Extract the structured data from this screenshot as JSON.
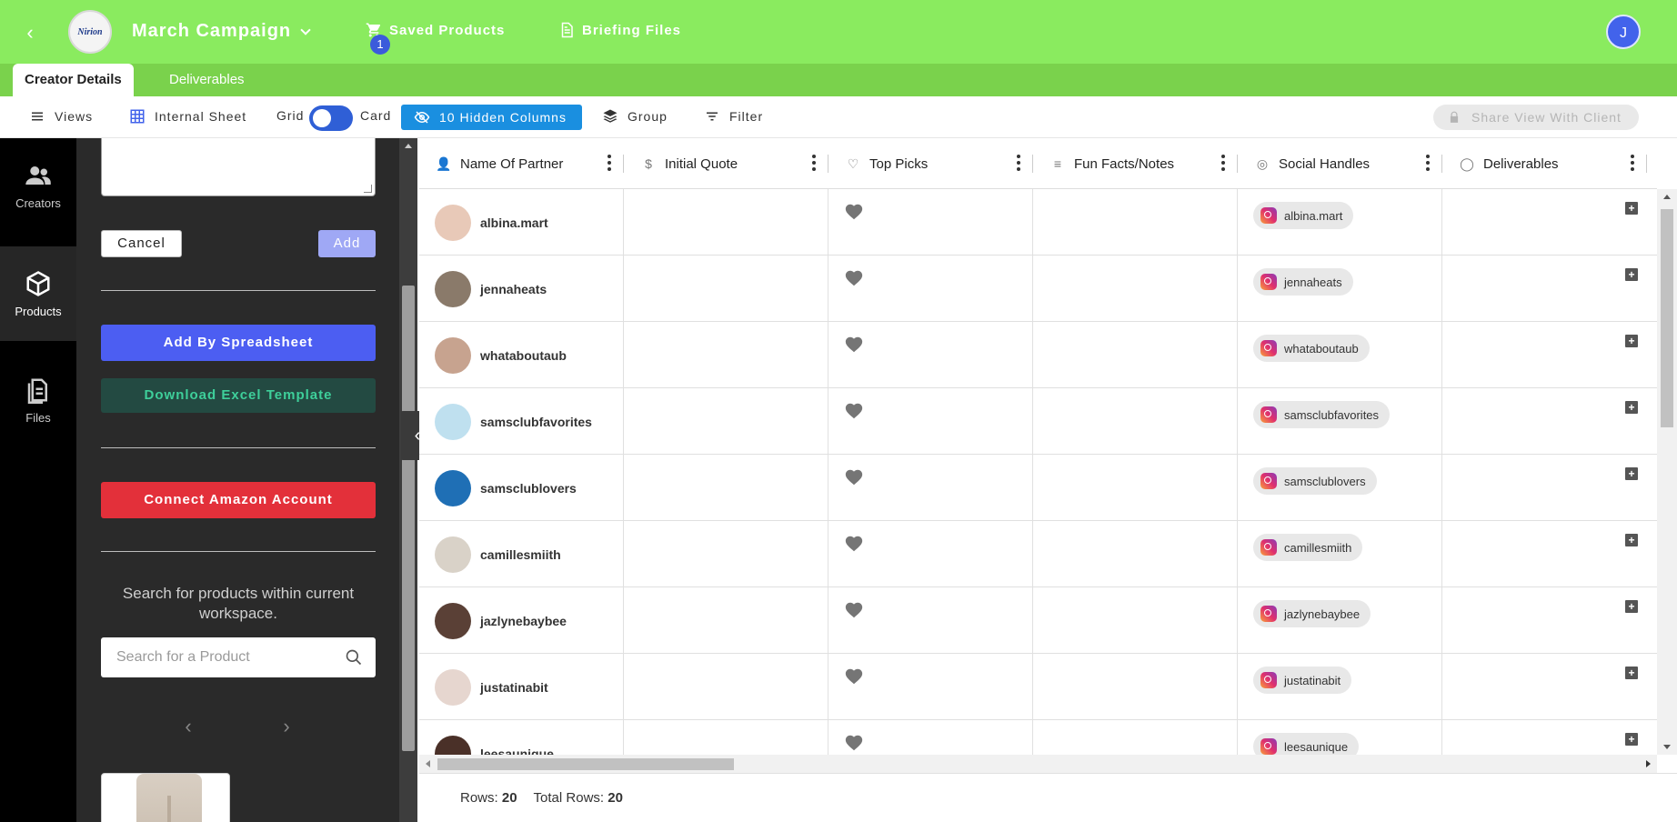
{
  "header": {
    "logo_text": "Nirion",
    "campaign_name": "March Campaign",
    "saved_products_label": "Saved Products",
    "saved_products_count": "1",
    "briefing_files_label": "Briefing Files",
    "user_initial": "J"
  },
  "tabs": [
    {
      "label": "Creator Details",
      "active": true
    },
    {
      "label": "Deliverables",
      "active": false
    }
  ],
  "toolbar": {
    "views_label": "Views",
    "sheet_label": "Internal Sheet",
    "grid_label": "Grid",
    "card_label": "Card",
    "hidden_columns_label": "10 Hidden Columns",
    "group_label": "Group",
    "filter_label": "Filter",
    "share_label": "Share View With Client"
  },
  "leftnav": {
    "items": [
      {
        "label": "Creators",
        "icon": "users-icon",
        "active": false
      },
      {
        "label": "Products",
        "icon": "box-icon",
        "active": true
      },
      {
        "label": "Files",
        "icon": "document-icon",
        "active": false
      }
    ]
  },
  "panel": {
    "cancel_label": "Cancel",
    "add_label": "Add",
    "spreadsheet_label": "Add By Spreadsheet",
    "excel_label": "Download Excel Template",
    "amazon_label": "Connect Amazon Account",
    "search_hint": "Search for products within current workspace.",
    "search_placeholder": "Search for a Product"
  },
  "table": {
    "columns": [
      {
        "label": "Name Of Partner",
        "icon": "person-icon"
      },
      {
        "label": "Initial Quote",
        "icon": "dollar-icon"
      },
      {
        "label": "Top Picks",
        "icon": "heart-outline-icon"
      },
      {
        "label": "Fun Facts/Notes",
        "icon": "lines-icon"
      },
      {
        "label": "Social Handles",
        "icon": "globe-icon"
      },
      {
        "label": "Deliverables",
        "icon": "circle-check-icon"
      }
    ],
    "rows": [
      {
        "partner": "albina.mart",
        "handle": "albina.mart",
        "avatar_color": "#e8c9b8"
      },
      {
        "partner": "jennaheats",
        "handle": "jennaheats",
        "avatar_color": "#8a7a6a"
      },
      {
        "partner": "whataboutaub",
        "handle": "whataboutaub",
        "avatar_color": "#c7a38f"
      },
      {
        "partner": "samsclubfavorites",
        "handle": "samsclubfavorites",
        "avatar_color": "#bfe0ef"
      },
      {
        "partner": "samsclublovers",
        "handle": "samsclublovers",
        "avatar_color": "#1f6fb5"
      },
      {
        "partner": "camillesmiith",
        "handle": "camillesmiith",
        "avatar_color": "#d9d2c8"
      },
      {
        "partner": "jazlynebaybee",
        "handle": "jazlynebaybee",
        "avatar_color": "#5a4036"
      },
      {
        "partner": "justatinabit",
        "handle": "justatinabit",
        "avatar_color": "#e6d6cf"
      },
      {
        "partner": "leesaunique",
        "handle": "leesaunique",
        "avatar_color": "#4a3028"
      }
    ]
  },
  "footer": {
    "rows_label": "Rows:",
    "rows_value": "20",
    "total_label": "Total Rows:",
    "total_value": "20"
  }
}
